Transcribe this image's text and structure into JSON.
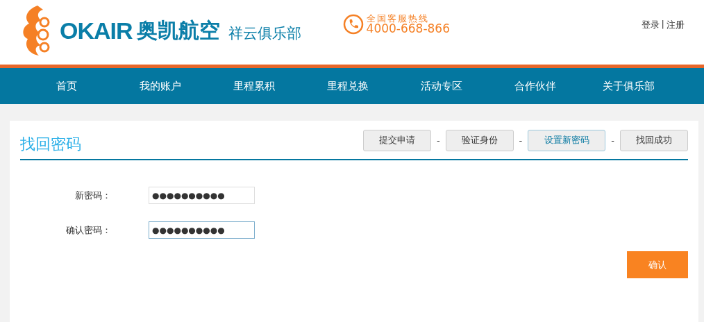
{
  "header": {
    "logo_latin": "OKAIR",
    "logo_cn": "奥凯航空",
    "club": "祥云俱乐部",
    "hotline_label": "全国客服热线",
    "hotline_number": "4000-668-866",
    "login": "登录",
    "separator": "|",
    "register": "注册"
  },
  "nav": [
    {
      "label": "首页"
    },
    {
      "label": "我的账户"
    },
    {
      "label": "里程累积"
    },
    {
      "label": "里程兑换"
    },
    {
      "label": "活动专区"
    },
    {
      "label": "合作伙伴"
    },
    {
      "label": "关于俱乐部"
    }
  ],
  "page_title": "找回密码",
  "steps": [
    {
      "label": "提交申请",
      "selected": false
    },
    {
      "label": "验证身份",
      "selected": false
    },
    {
      "label": "设置新密码",
      "selected": true
    },
    {
      "label": "找回成功",
      "selected": false
    }
  ],
  "step_separator": "-",
  "fields": [
    {
      "label": "新密码：",
      "value": "●●●●●●●●●●",
      "focused": false
    },
    {
      "label": "确认密码：",
      "value": "●●●●●●●●●●",
      "focused": true
    }
  ],
  "confirm_button": "确认"
}
